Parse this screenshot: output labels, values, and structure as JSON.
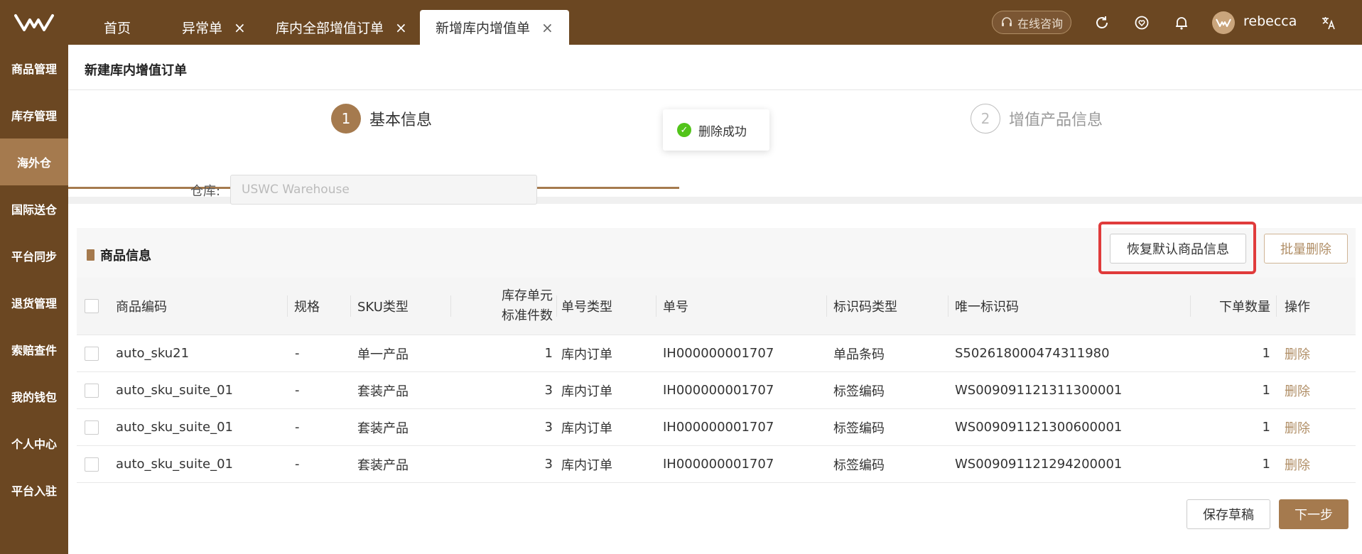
{
  "tabs": [
    {
      "label": "首页",
      "closable": false
    },
    {
      "label": "异常单",
      "closable": true,
      "close": "×"
    },
    {
      "label": "库内全部增值订单",
      "closable": true,
      "close": "×"
    },
    {
      "label": "新增库内增值单",
      "closable": true,
      "close": "×",
      "active": true
    }
  ],
  "header": {
    "consult_label": "在线咨询",
    "username": "rebecca"
  },
  "sidebar": {
    "items": [
      {
        "label": "商品管理"
      },
      {
        "label": "库存管理"
      },
      {
        "label": "海外仓",
        "active": true
      },
      {
        "label": "国际送仓"
      },
      {
        "label": "平台同步"
      },
      {
        "label": "退货管理"
      },
      {
        "label": "索赔查件"
      },
      {
        "label": "我的钱包"
      },
      {
        "label": "个人中心"
      },
      {
        "label": "平台入驻"
      }
    ]
  },
  "page": {
    "title": "新建库内增值订单",
    "steps": [
      {
        "num": "1",
        "label": "基本信息",
        "active": true
      },
      {
        "num": "2",
        "label": "增值产品信息",
        "active": false
      }
    ],
    "toast": "删除成功",
    "warehouse_label": "仓库:",
    "warehouse_value": "USWC Warehouse",
    "section_title": "商品信息",
    "restore_button": "恢复默认商品信息",
    "batch_delete_button": "批量删除",
    "save_draft_button": "保存草稿",
    "next_button": "下一步"
  },
  "table": {
    "headers": {
      "code": "商品编码",
      "spec": "规格",
      "sku_type": "SKU类型",
      "unit_line1": "库存单元",
      "unit_line2": "标准件数",
      "order_type": "单号类型",
      "order_no": "单号",
      "id_type": "标识码类型",
      "unique_id": "唯一标识码",
      "qty": "下单数量",
      "action": "操作"
    },
    "rows": [
      {
        "code": "auto_sku21",
        "spec": "-",
        "sku_type": "单一产品",
        "unit": "1",
        "order_type": "库内订单",
        "order_no": "IH000000001707",
        "id_type": "单品条码",
        "unique_id": "S502618000474311980",
        "qty": "1",
        "action": "删除"
      },
      {
        "code": "auto_sku_suite_01",
        "spec": "-",
        "sku_type": "套装产品",
        "unit": "3",
        "order_type": "库内订单",
        "order_no": "IH000000001707",
        "id_type": "标签编码",
        "unique_id": "WS009091121311300001",
        "qty": "1",
        "action": "删除"
      },
      {
        "code": "auto_sku_suite_01",
        "spec": "-",
        "sku_type": "套装产品",
        "unit": "3",
        "order_type": "库内订单",
        "order_no": "IH000000001707",
        "id_type": "标签编码",
        "unique_id": "WS009091121300600001",
        "qty": "1",
        "action": "删除"
      },
      {
        "code": "auto_sku_suite_01",
        "spec": "-",
        "sku_type": "套装产品",
        "unit": "3",
        "order_type": "库内订单",
        "order_no": "IH000000001707",
        "id_type": "标签编码",
        "unique_id": "WS009091121294200001",
        "qty": "1",
        "action": "删除"
      }
    ]
  },
  "colors": {
    "brand": "#6b4722",
    "accent": "#a57a4e",
    "success": "#52c41a",
    "highlight": "#e03b3b"
  },
  "icons": [
    "logo",
    "headset-icon",
    "refresh-icon",
    "heart-icon",
    "bell-icon",
    "avatar",
    "translate-icon",
    "close-icon",
    "check-icon",
    "book-icon"
  ]
}
